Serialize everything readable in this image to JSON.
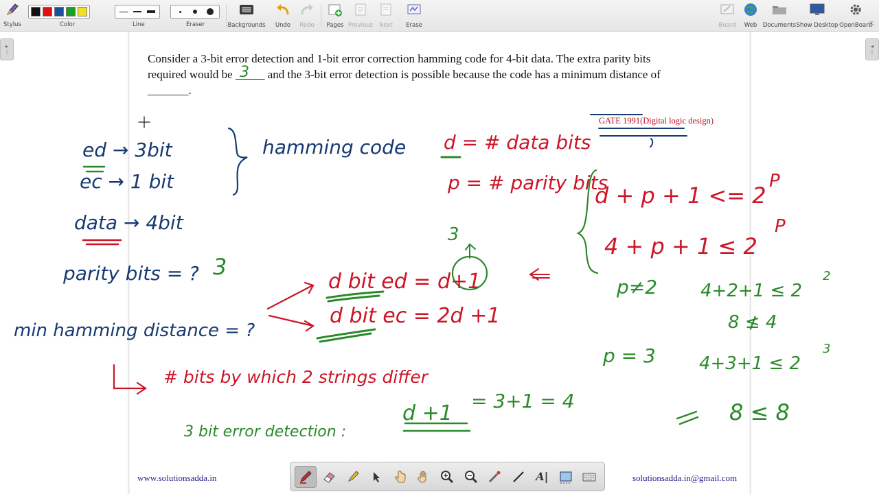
{
  "toolbar": {
    "stylus": "Stylus",
    "color": "Color",
    "line": "Line",
    "eraser": "Eraser",
    "backgrounds": "Backgrounds",
    "undo": "Undo",
    "redo": "Redo",
    "pages": "Pages",
    "previous": "Previous",
    "next": "Next",
    "erase": "Erase",
    "board": "Board",
    "web": "Web",
    "documents": "Documents",
    "show_desktop": "Show Desktop",
    "openboard": "OpenBoard",
    "swatches": [
      "#111111",
      "#e01010",
      "#1c4fa0",
      "#1aa01a",
      "#f0e020"
    ]
  },
  "question": {
    "line1": "Consider a 3-bit error detection and 1-bit error correction hamming code for 4-bit data. The extra parity bits",
    "line2_a": "required would be ",
    "blank1": "_____",
    "answer1": "3",
    "line2_b": " and the 3-bit error detection is possible because the code has a minimum distance of",
    "line3": "_______."
  },
  "source_tag": "GATE 1991(Digital logic design)",
  "annotations": {
    "blue": {
      "ed": "ed → 3bit",
      "ec": "ec → 1 bit",
      "brace_label": "hamming code",
      "data": "data → 4bit",
      "parity_bits": "parity bits = ?",
      "min_hamming": "min hamming distance = ?"
    },
    "red": {
      "d_def": "d = # data bits",
      "p_def": "p = # parity bits",
      "ineq1": "d + p + 1 <= 2",
      "exp_p1": "P",
      "ineq2": "4 + p + 1 ≤ 2",
      "exp_p2": "P",
      "dbit_ed": "d bit ed = d+1",
      "dbit_ec": "d bit ec = 2d +1",
      "bits_differ": "# bits by which 2 strings differ"
    },
    "green": {
      "three_top": "3",
      "parity_ans": "3",
      "p_ne_2": "p≠2",
      "check2": "4+2+1 ≤ 2",
      "exp2": "2",
      "eight_not_four": "8 ≰ 4",
      "p_eq_3": "p = 3",
      "check3": "4+3+1 ≤ 2",
      "exp3": "3",
      "eight_le_eight": "8 ≤ 8",
      "detection": "3 bit error detection :",
      "d_plus_1": "d +1",
      "result": "= 3+1 = 4"
    }
  },
  "footer": {
    "left": "www.solutionsadda.in",
    "right": "solutionsadda.in@gmail.com"
  }
}
